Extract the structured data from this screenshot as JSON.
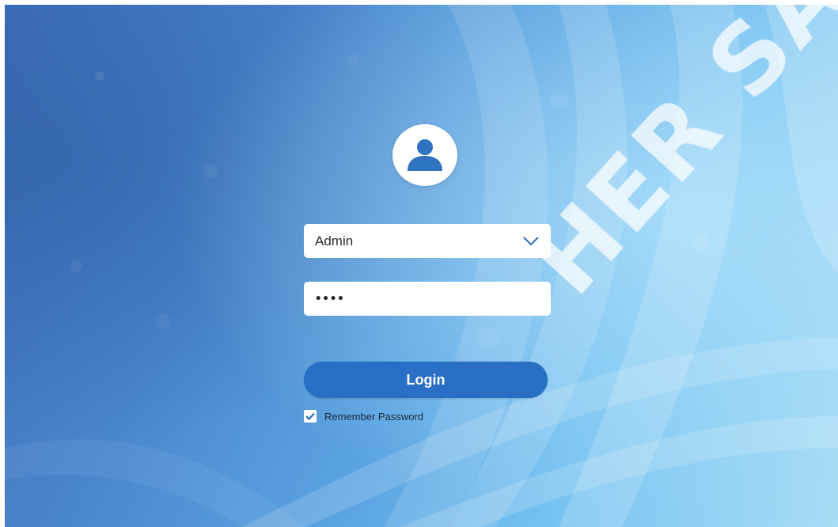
{
  "login_form": {
    "user_select_value": "Admin",
    "password_masked": "••••",
    "login_label": "Login",
    "remember_label": "Remember Password",
    "remember_checked": true
  },
  "watermark": {
    "text": "HER SA"
  },
  "icons": {
    "avatar": "user-avatar-icon",
    "dropdown": "chevron-down-icon",
    "checkbox": "checkmark-icon"
  },
  "colors": {
    "accent": "#2a6fc6",
    "avatar_icon": "#2f74c0",
    "checkbox": "#2a6fc6"
  }
}
